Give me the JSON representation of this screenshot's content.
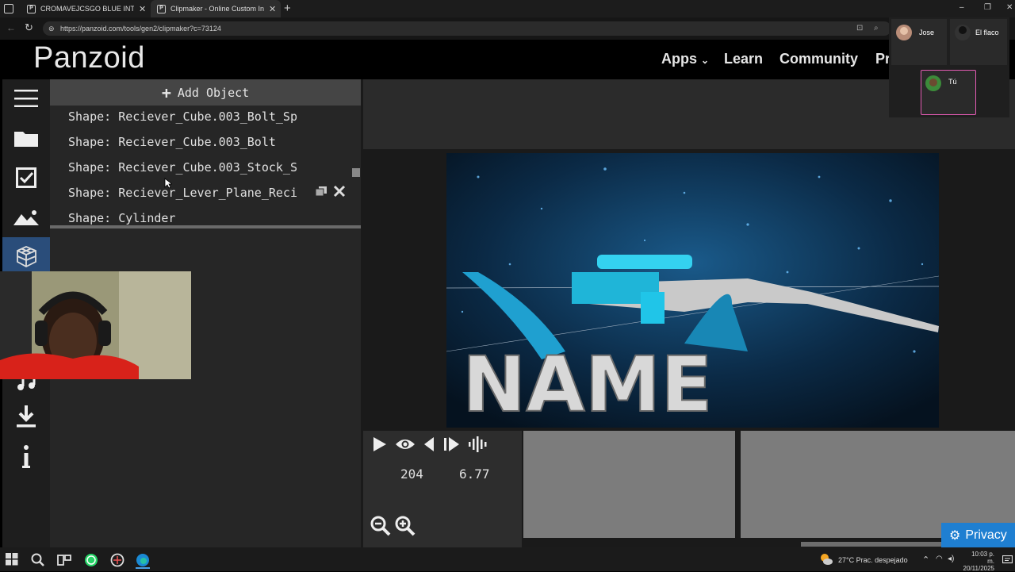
{
  "browser": {
    "tabs": [
      {
        "label": "CROMAVEJCSGO BLUE INTRO TE",
        "favicon": "P"
      },
      {
        "label": "Clipmaker - Online Custom Intro",
        "favicon": "P"
      }
    ],
    "new_tab": "+",
    "url": "https://panzoid.com/tools/gen2/clipmaker?c=73124",
    "window_controls": [
      "–",
      "❐",
      "✕"
    ]
  },
  "site": {
    "logo": "Panzoid",
    "nav": {
      "apps": "Apps",
      "apps_caret": "⌄",
      "learn": "Learn",
      "community": "Community",
      "pr": "Pr"
    }
  },
  "sidebar_icons": [
    "menu-icon",
    "folder-icon",
    "checkbox-icon",
    "landscape-icon",
    "cube-wireframe-icon",
    "music-icon",
    "download-icon",
    "info-icon"
  ],
  "object_panel": {
    "add_label": "Add Object",
    "add_icon": "+",
    "items": [
      "Shape: Reciever_Cube.003_Bolt_Sp",
      "Shape: Reciever_Cube.003_Bolt",
      "Shape: Reciever_Cube.003_Stock_S",
      "Shape: Reciever_Lever_Plane_Reci",
      "Shape: Cylinder"
    ]
  },
  "preview": {
    "text_3d": "NAME",
    "frame": "204",
    "time": "6.77"
  },
  "privacy": {
    "label": "Privacy"
  },
  "meeting": {
    "participants": [
      "Jose",
      "El flaco",
      "Tú"
    ]
  },
  "taskbar": {
    "weather": "27°C  Prac. despejado",
    "time": "10:03 p. m.",
    "date": "20/11/2025"
  },
  "colors": {
    "accent": "#2a8fe0",
    "selected_tile_border": "#e35bb3"
  }
}
